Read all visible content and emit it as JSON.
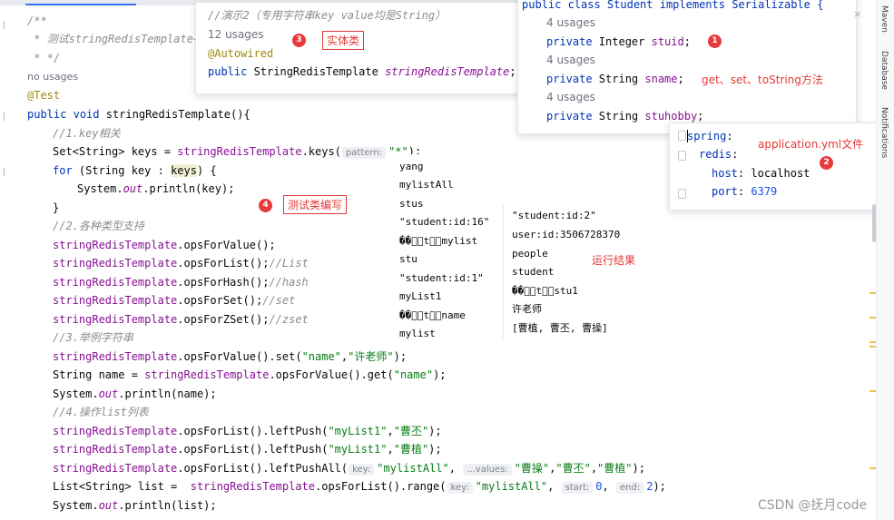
{
  "main": {
    "doc_open": "/**",
    "doc_body": " * 测试stringRedisTemplate+",
    "doc_close": " * */",
    "usages_main": "no usages",
    "annotation": "@Test",
    "kw_public": "public",
    "kw_void": "void",
    "method_name": "stringRedisTemplate",
    "method_tail": "(){",
    "c1": "//1.key相关",
    "set_type": "Set<String> keys = ",
    "rt": "stringRedisTemplate",
    "keys_call": ".keys(",
    "pattern_hint": "pattern:",
    "pattern_val": "\"*\"",
    "close_semi": ");",
    "kw_for": "for",
    "for_mid": " (String key : ",
    "for_keys": "keys",
    "for_tail": ") {",
    "sys": "System.",
    "out": "out",
    "println_key": ".println(key);",
    "brace_close": "}",
    "c2": "//2.各种类型支持",
    "ops_value": ".opsForValue();",
    "ops_list": ".opsForList();",
    "cmt_list": "//List",
    "ops_hash": ".opsForHash();",
    "cmt_hash": "//hash",
    "ops_set": ".opsForSet();",
    "cmt_set": "//set",
    "ops_zset": ".opsForZSet();",
    "cmt_zset": "//zset",
    "c3": "//3.举例字符串",
    "set_call": ".opsForValue().set(",
    "str_name": "\"name\"",
    "comma": ",",
    "str_teacher": "\"许老师\"",
    "string_name": "String name = ",
    "get_call": ".opsForValue().get(",
    "println_name": ".println(name);",
    "c4": "//4.操作list列表",
    "leftpush_call": ".opsForList().leftPush(",
    "str_mylist1": "\"myList1\"",
    "str_caopi": "\"曹丕\"",
    "str_caozhi": "\"曹植\"",
    "leftpushall_call": ".opsForList().leftPushAll(",
    "key_hint": "key:",
    "str_mylistall": "\"mylistAll\"",
    "values_hint": "...values:",
    "str_caocao": "\"曹操\"",
    "list_decl": "List<String> list = ",
    "range_call": ".opsForList().range(",
    "start_hint": "start:",
    "num_0": "0",
    "end_hint": "end:",
    "num_2": "2",
    "println_list": ".println(list);"
  },
  "popup_demo": {
    "comment": "//演示2（专用字符串key value均是String）",
    "usages": "12 usages",
    "annotation": "@Autowired",
    "decl_kw": "public",
    "decl_type": " StringRedisTemplate ",
    "decl_field": "stringRedisTemplate",
    "semi": ";"
  },
  "popup_student": {
    "header": "public class Student implements Serializable {",
    "usages1": "4 usages",
    "f1_kw": "private",
    "f1_type": " Integer ",
    "f1_name": "stuid",
    "usages2": "4 usages",
    "f2_kw": "private",
    "f2_type": " String ",
    "f2_name": "sname",
    "usages3": "4 usages",
    "f3_kw": "private",
    "f3_type": " String ",
    "f3_name": "stuhobby",
    "semi": ";"
  },
  "popup_yml": {
    "spring": "spring",
    "colon": ":",
    "redis": "redis",
    "host_key": "host",
    "host_val": "localhost",
    "port_key": "port",
    "port_val": "6379"
  },
  "results": {
    "col1": [
      "yang",
      "mylistAll",
      "stus",
      "\"student:id:16\"",
      "��\u0000\u0005t\u0000\u0006mylist",
      "stu",
      "\"student:id:1\"",
      "myList1",
      "��\u0000\u0005t\u0000\u0004name",
      "mylist"
    ],
    "col2": [
      "\"student:id:2\"",
      "user:id:3506728370",
      "people",
      "student",
      "��\u0000\u0005t\u0000\u0004stu1",
      "许老师",
      "[曹植, 曹丕, 曹操]"
    ]
  },
  "annotations": {
    "badge1": "1",
    "label1": "get、set、toString方法",
    "badge2": "2",
    "label2": "application.yml文件",
    "badge3": "3",
    "label3": "实体类",
    "badge4": "4",
    "label4": "测试类编写",
    "label_result": "运行结果",
    "annotation_color": "#e53935"
  },
  "side": {
    "maven": "Maven",
    "database": "Database",
    "notifications": "Notifications",
    "close_icon": "×"
  },
  "watermark": "CSDN @抚月code"
}
